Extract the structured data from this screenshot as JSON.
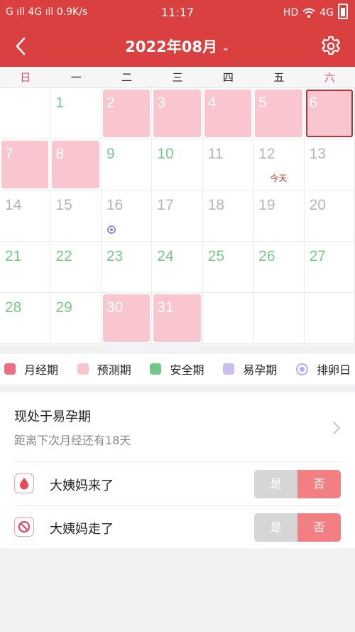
{
  "status_bar": {
    "left": "G ıll 4G ıll 0.9K/s",
    "time": "11:17",
    "right": "HD",
    "net": "4G"
  },
  "header": {
    "title": "2022年08月",
    "chevron": "⌄"
  },
  "weekdays": [
    "日",
    "一",
    "二",
    "三",
    "四",
    "五",
    "六"
  ],
  "calendar": {
    "days": [
      {
        "n": "",
        "t": "blank"
      },
      {
        "n": "1",
        "t": "safe"
      },
      {
        "n": "2",
        "t": "pred"
      },
      {
        "n": "3",
        "t": "pred"
      },
      {
        "n": "4",
        "t": "pred"
      },
      {
        "n": "5",
        "t": "pred"
      },
      {
        "n": "6",
        "t": "pred",
        "sel": true
      },
      {
        "n": "7",
        "t": "pred"
      },
      {
        "n": "8",
        "t": "pred"
      },
      {
        "n": "9",
        "t": "safe"
      },
      {
        "n": "10",
        "t": "safe"
      },
      {
        "n": "11",
        "t": "fert"
      },
      {
        "n": "12",
        "t": "fert",
        "today": "今天"
      },
      {
        "n": "13",
        "t": "fert"
      },
      {
        "n": "14",
        "t": "fert"
      },
      {
        "n": "15",
        "t": "fert"
      },
      {
        "n": "16",
        "t": "fert",
        "ovu": true
      },
      {
        "n": "17",
        "t": "fert"
      },
      {
        "n": "18",
        "t": "fert"
      },
      {
        "n": "19",
        "t": "fert"
      },
      {
        "n": "20",
        "t": "fert"
      },
      {
        "n": "21",
        "t": "safe"
      },
      {
        "n": "22",
        "t": "safe"
      },
      {
        "n": "23",
        "t": "safe"
      },
      {
        "n": "24",
        "t": "safe"
      },
      {
        "n": "25",
        "t": "safe"
      },
      {
        "n": "26",
        "t": "safe"
      },
      {
        "n": "27",
        "t": "safe"
      },
      {
        "n": "28",
        "t": "safe"
      },
      {
        "n": "29",
        "t": "safe"
      },
      {
        "n": "30",
        "t": "pred"
      },
      {
        "n": "31",
        "t": "pred"
      },
      {
        "n": "",
        "t": "blank"
      },
      {
        "n": "",
        "t": "blank"
      },
      {
        "n": "",
        "t": "blank"
      }
    ]
  },
  "legend": [
    {
      "label": "月经期",
      "color": "#ee6f83"
    },
    {
      "label": "预测期",
      "color": "#f9c6cf"
    },
    {
      "label": "安全期",
      "color": "#6fc987"
    },
    {
      "label": "易孕期",
      "color": "#c9bdf0"
    },
    {
      "label": "排卵日",
      "color": "#b9a9ee",
      "ring": true
    }
  ],
  "status": {
    "title": "现处于易孕期",
    "subtitle": "距离下次月经还有18天"
  },
  "toggles": [
    {
      "label": "大姨妈来了",
      "icon": "drop-icon",
      "yes": "是",
      "no": "否"
    },
    {
      "label": "大姨妈走了",
      "icon": "ban-icon",
      "yes": "是",
      "no": "否"
    }
  ],
  "colors": {
    "primary": "#d9403f",
    "predicted": "#f9c6cf",
    "safe": "#78c98a",
    "fertile_text": "#b3b3c4",
    "toggle_no": "#f27f82"
  }
}
